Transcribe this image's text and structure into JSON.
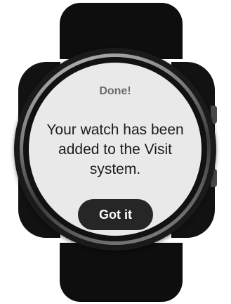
{
  "dialog": {
    "title": "Done!",
    "message": "Your watch has been added to the Visit system.",
    "confirm_label": "Got it"
  },
  "colors": {
    "screen_background": "#e9e9e9",
    "title_text": "#6a6a6a",
    "message_text": "#1c1c1c",
    "button_background": "#262626",
    "button_text": "#ffffff",
    "watch_body": "#121212"
  }
}
